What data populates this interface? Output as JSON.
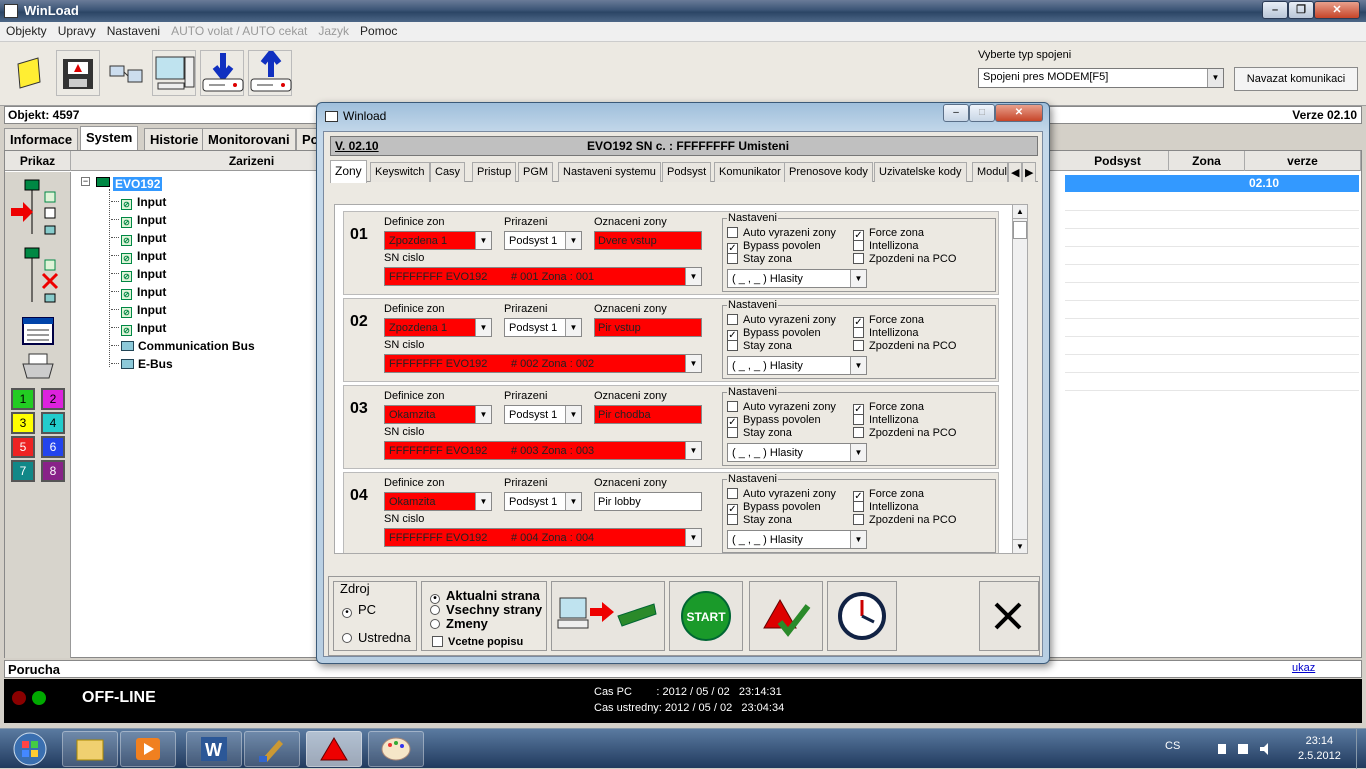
{
  "app": {
    "title": "WinLoad"
  },
  "menu": [
    "Objekty",
    "Upravy",
    "Nastaveni",
    "AUTO volat / AUTO cekat",
    "Jazyk",
    "Pomoc"
  ],
  "connection": {
    "label": "Vyberte typ spojeni",
    "value": "Spojeni pres MODEM[F5]",
    "connect_button": "Navazat komunikaci"
  },
  "objstrip": {
    "object": "Objekt: 4597",
    "version": "Verze 02.10"
  },
  "tabs": [
    "Informace",
    "System",
    "Historie",
    "Monitorovani",
    "Po"
  ],
  "columns": {
    "prikaz": "Prikaz",
    "zarizeni": "Zarizeni",
    "podsyst": "Podsyst",
    "zona": "Zona",
    "verze": "verze"
  },
  "tree": {
    "root": "EVO192",
    "children": [
      "Input",
      "Input",
      "Input",
      "Input",
      "Input",
      "Input",
      "Input",
      "Input",
      "Communication Bus",
      "E-Bus"
    ]
  },
  "selected_row": {
    "verze": "02.10"
  },
  "numbers": [
    "1",
    "2",
    "3",
    "4",
    "5",
    "6",
    "7",
    "8"
  ],
  "number_colors": [
    "#22cc22",
    "#dd22dd",
    "#ffff00",
    "#22cccc",
    "#ee2222",
    "#2244ee",
    "#118888",
    "#882288"
  ],
  "poruch": {
    "label": "Porucha",
    "ukaz": "ukaz"
  },
  "status": {
    "state": "OFF-LINE",
    "cas_pc": "Cas PC        : 2012 / 05 / 02   23:14:31",
    "cas_ustredna": "Cas ustredny: 2012 / 05 / 02   23:04:34"
  },
  "dialog": {
    "title": "Winload",
    "version": "V. 02.10",
    "header": "EVO192  SN c. : FFFFFFFF Umisteni",
    "subtabs": [
      "Zony",
      "Keyswitch",
      "Casy",
      "Pristup",
      "PGM",
      "Nastaveni systemu",
      "Podsyst",
      "Komunikator",
      "Prenosove kody",
      "Uzivatelske kody",
      "Moduly"
    ],
    "field_labels": {
      "definice": "Definice zon",
      "prirazeni": "Prirazeni",
      "oznaceni": "Oznaceni zony",
      "sn": "SN cislo",
      "nastaveni": "Nastaveni"
    },
    "options": {
      "auto": "Auto vyrazeni zony",
      "bypass": "Bypass povolen",
      "stay": "Stay zona",
      "force": "Force zona",
      "intelli": "Intellizona",
      "zpozdeni": "Zpozdeni na PCO"
    },
    "zones": [
      {
        "num": "01",
        "definice": "Zpozdena 1",
        "prirazeni": "Podsyst 1",
        "oznaceni": "Dvere vstup",
        "oznaceni_red": true,
        "sn": "FFFFFFFF EVO192",
        "sn_zone": "# 001 Zona    : 001",
        "hlasity": "( _ , _ ) Hlasity",
        "auto": false,
        "bypass": true,
        "stay": false,
        "force": true,
        "intelli": false,
        "zpozdeni": false
      },
      {
        "num": "02",
        "definice": "Zpozdena 1",
        "prirazeni": "Podsyst 1",
        "oznaceni": "Pir vstup",
        "oznaceni_red": true,
        "sn": "FFFFFFFF EVO192",
        "sn_zone": "# 002 Zona    : 002",
        "hlasity": "( _ , _ ) Hlasity",
        "auto": false,
        "bypass": true,
        "stay": false,
        "force": true,
        "intelli": false,
        "zpozdeni": false
      },
      {
        "num": "03",
        "definice": "Okamzita",
        "prirazeni": "Podsyst 1",
        "oznaceni": "Pir chodba",
        "oznaceni_red": true,
        "sn": "FFFFFFFF EVO192",
        "sn_zone": "# 003 Zona    : 003",
        "hlasity": "( _ , _ ) Hlasity",
        "auto": false,
        "bypass": true,
        "stay": false,
        "force": true,
        "intelli": false,
        "zpozdeni": false
      },
      {
        "num": "04",
        "definice": "Okamzita",
        "prirazeni": "Podsyst 1",
        "oznaceni": "Pir lobby",
        "oznaceni_red": false,
        "sn": "FFFFFFFF EVO192",
        "sn_zone": "# 004 Zona    : 004",
        "hlasity": "( _ , _ ) Hlasity",
        "auto": false,
        "bypass": true,
        "stay": false,
        "force": true,
        "intelli": false,
        "zpozdeni": false
      }
    ],
    "zdroj": {
      "label": "Zdroj",
      "pc": "PC",
      "ustredna": "Ustredna"
    },
    "scope": {
      "aktualni": "Aktualni strana",
      "vsechny": "Vsechny strany",
      "zmeny": "Zmeny",
      "popisu": "Vcetne popisu"
    },
    "start": "START"
  },
  "taskbar": {
    "lang": "CS",
    "time": "23:14",
    "date": "2.5.2012"
  }
}
